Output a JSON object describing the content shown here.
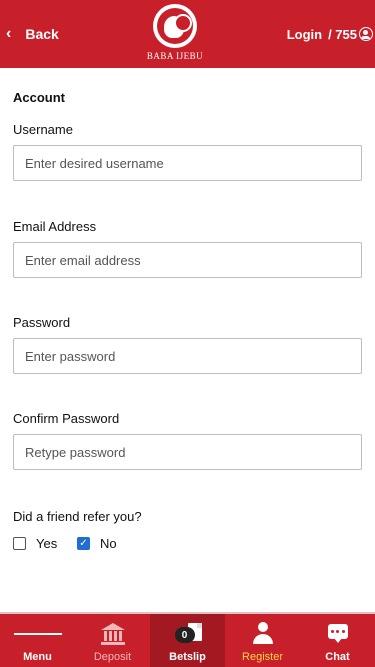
{
  "header": {
    "back_label": "Back",
    "logo_text": "BABA IJEBU",
    "login_label": "Login",
    "separator_value": "/ 755"
  },
  "form": {
    "section_title": "Account",
    "fields": [
      {
        "label": "Username",
        "placeholder": "Enter desired username"
      },
      {
        "label": "Email Address",
        "placeholder": "Enter email address"
      },
      {
        "label": "Password",
        "placeholder": "Enter password"
      },
      {
        "label": "Confirm Password",
        "placeholder": "Retype password"
      }
    ],
    "refer_question": "Did a friend refer you?",
    "refer_options": [
      {
        "label": "Yes",
        "checked": false
      },
      {
        "label": "No",
        "checked": true
      }
    ]
  },
  "bottom_nav": {
    "items": [
      {
        "label": "Menu",
        "icon": "menu-icon"
      },
      {
        "label": "Deposit",
        "icon": "bank-icon"
      },
      {
        "label": "Betslip",
        "icon": "betslip-icon",
        "badge": "0"
      },
      {
        "label": "Register",
        "icon": "user-icon"
      },
      {
        "label": "Chat",
        "icon": "chat-icon"
      }
    ]
  },
  "colors": {
    "brand_red": "#c8202a",
    "active_dark_red": "#a31922",
    "register_highlight": "#ffd34d",
    "checkbox_blue": "#1f6fd1"
  }
}
